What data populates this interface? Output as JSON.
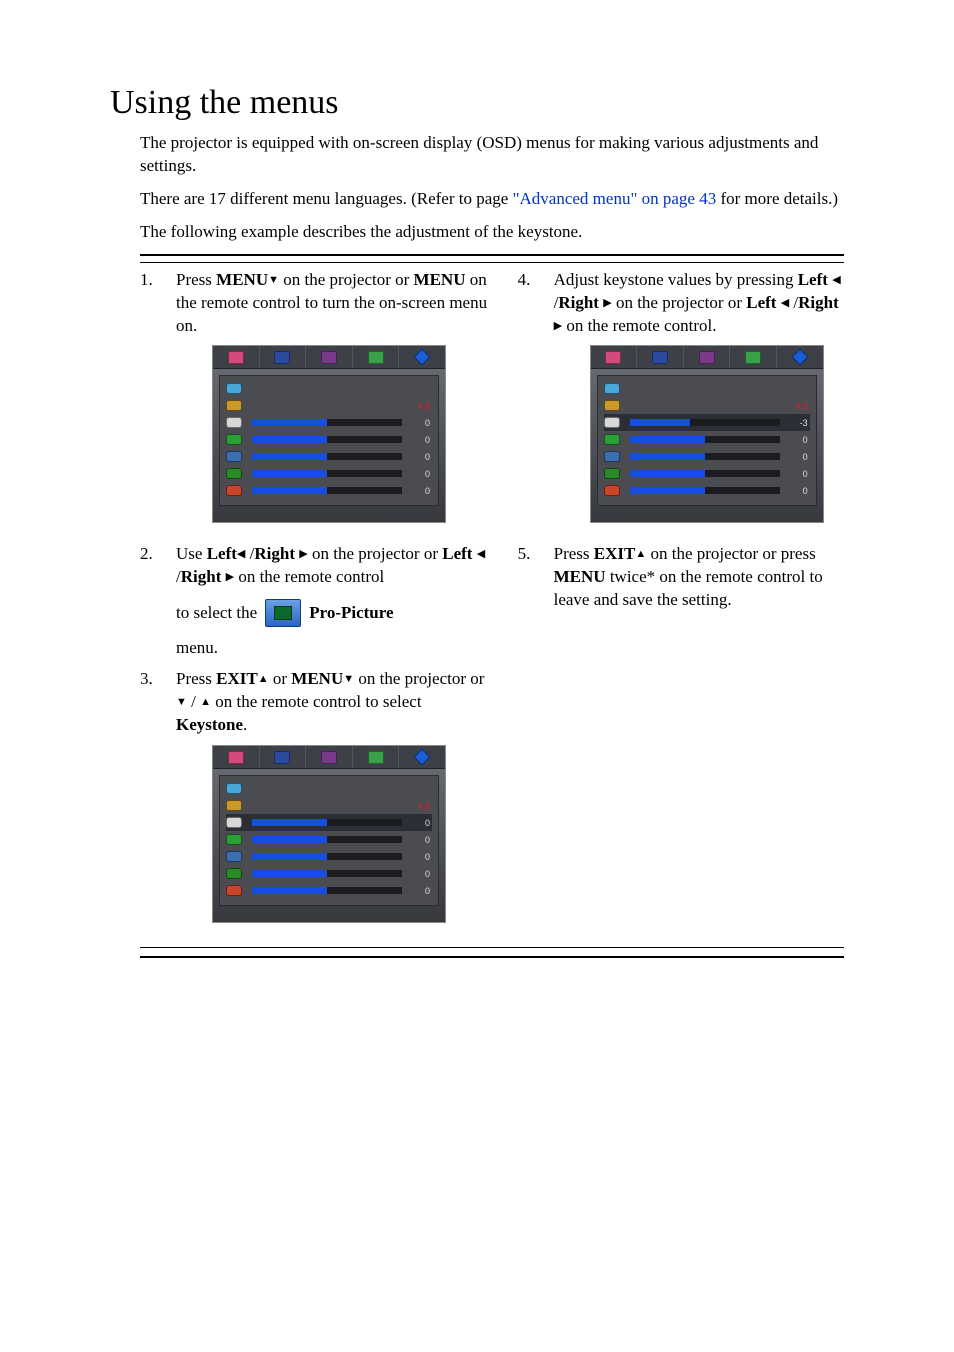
{
  "title": "Using the menus",
  "p1": "The projector is equipped with on-screen display (OSD) menus for making various adjustments and settings.",
  "p2_a": "There are 17 different menu languages. (Refer to page ",
  "p2_link": "\"Advanced menu\" on page 43",
  "p2_b": " for more details.)",
  "p3": "The following example describes the adjustment of the keystone.",
  "steps": {
    "s1": {
      "num": "1.",
      "a": "Press ",
      "menu": "MENU",
      "b": " on the projector or ",
      "c": " on the remote control to turn the on-screen menu on."
    },
    "s2": {
      "num": "2.",
      "a": "Use  ",
      "left": "Left",
      "right": "Right",
      "b": " on the projector or ",
      "c": " on the remote control",
      "d": "to select the ",
      "pro": "Pro-Picture",
      "e": "menu."
    },
    "s3": {
      "num": "3.",
      "a": "Press ",
      "exit": "EXIT",
      "menu": "MENU",
      "b": " or ",
      "c": " on the projector or ",
      "d": " on the remote control to select ",
      "key": "Keystone",
      "dot": "."
    },
    "s4": {
      "num": "4.",
      "a": "Adjust keystone values by pressing ",
      "left": "Left",
      "right": "Right",
      "b": " on the projector or ",
      "c": "  on the remote control."
    },
    "s5": {
      "num": "5.",
      "a": "Press ",
      "exit": "EXIT",
      "b": " on the projector or press ",
      "menu": "MENU",
      "c": " twice* on the remote control to leave and save the setting."
    }
  },
  "osd1": {
    "rows": [
      {
        "color": "#4aa7d8",
        "value": "",
        "red": false,
        "fill": 0,
        "showbar": false
      },
      {
        "color": "#c99a2a",
        "value": "4:3",
        "red": true,
        "fill": 0,
        "showbar": false
      },
      {
        "color": "#d8d8d8",
        "value": "0",
        "red": false,
        "fill": 50,
        "showbar": true
      },
      {
        "color": "#2aa037",
        "value": "0",
        "red": false,
        "fill": 50,
        "showbar": true
      },
      {
        "color": "#3a6fb0",
        "value": "0",
        "red": false,
        "fill": 50,
        "showbar": true
      },
      {
        "color": "#2a8a2a",
        "value": "0",
        "red": false,
        "fill": 50,
        "showbar": true
      },
      {
        "color": "#c9452a",
        "value": "0",
        "red": false,
        "fill": 50,
        "showbar": true
      }
    ]
  },
  "osd2": {
    "rows": [
      {
        "color": "#4aa7d8",
        "value": "",
        "red": false,
        "fill": 0,
        "showbar": false,
        "sel": false
      },
      {
        "color": "#c99a2a",
        "value": "4:3",
        "red": true,
        "fill": 0,
        "showbar": false,
        "sel": false
      },
      {
        "color": "#d8d8d8",
        "value": "0",
        "red": false,
        "fill": 50,
        "showbar": true,
        "sel": true
      },
      {
        "color": "#2aa037",
        "value": "0",
        "red": false,
        "fill": 50,
        "showbar": true,
        "sel": false
      },
      {
        "color": "#3a6fb0",
        "value": "0",
        "red": false,
        "fill": 50,
        "showbar": true,
        "sel": false
      },
      {
        "color": "#2a8a2a",
        "value": "0",
        "red": false,
        "fill": 50,
        "showbar": true,
        "sel": false
      },
      {
        "color": "#c9452a",
        "value": "0",
        "red": false,
        "fill": 50,
        "showbar": true,
        "sel": false
      }
    ]
  },
  "osd3": {
    "rows": [
      {
        "color": "#4aa7d8",
        "value": "",
        "red": false,
        "fill": 0,
        "showbar": false,
        "sel": false
      },
      {
        "color": "#c99a2a",
        "value": "4:3",
        "red": true,
        "fill": 0,
        "showbar": false,
        "sel": false
      },
      {
        "color": "#d8d8d8",
        "value": "-3",
        "red": false,
        "fill": 40,
        "showbar": true,
        "sel": true
      },
      {
        "color": "#2aa037",
        "value": "0",
        "red": false,
        "fill": 50,
        "showbar": true,
        "sel": false
      },
      {
        "color": "#3a6fb0",
        "value": "0",
        "red": false,
        "fill": 50,
        "showbar": true,
        "sel": false
      },
      {
        "color": "#2a8a2a",
        "value": "0",
        "red": false,
        "fill": 50,
        "showbar": true,
        "sel": false
      },
      {
        "color": "#c9452a",
        "value": "0",
        "red": false,
        "fill": 50,
        "showbar": true,
        "sel": false
      }
    ]
  },
  "tabs": [
    {
      "bg": "#3e4048",
      "name": "picture-tab"
    },
    {
      "bg": "#3e4048",
      "name": "pro-picture-tab"
    },
    {
      "bg": "#3e4048",
      "name": "setting-tab"
    },
    {
      "bg": "#3e4048",
      "name": "advanced-tab"
    },
    {
      "bg": "#3e4048",
      "name": "info-tab"
    }
  ]
}
